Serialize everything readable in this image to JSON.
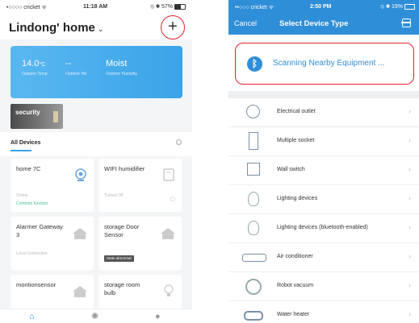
{
  "left": {
    "status": {
      "carrier": "•○○○○ cricket ᯤ",
      "time": "11:18 AM",
      "battery": "⦸ ✱ 57%"
    },
    "home_title": "Lindong' home",
    "add_label": "+",
    "weather": {
      "temp": "14.0",
      "temp_unit": "°C",
      "temp_label": "Outdoor Temp",
      "humidity": "--",
      "humidity_label": "Outdoor Hd",
      "quality": "Moist",
      "quality_label": "Outdoor Humidity"
    },
    "security_label": "security",
    "section_label": "All Devices",
    "cards": [
      {
        "name": "home 7C",
        "status": "Online",
        "extra": "Common function"
      },
      {
        "name": "WIFI humidifier",
        "status": "Turned Off"
      },
      {
        "name": "Alarmer Gateway 3",
        "status": "Local Connection"
      },
      {
        "name": "storage Door Sensor",
        "badge": "State abnormal"
      },
      {
        "name": "montionsensor"
      },
      {
        "name": "storage room bulb"
      }
    ],
    "tabs": [
      "⌂",
      "✺",
      "●"
    ]
  },
  "right": {
    "status": {
      "carrier": "••○○○ cricket ᯤ",
      "time": "2:50 PM",
      "battery": "⦸ ✱ 19%"
    },
    "cancel_label": "Cancel",
    "title": "Select Device Type",
    "scan_text": "Scanning Nearby Equipment ...",
    "bluetooth_glyph": "ᛒ",
    "arrow": "›",
    "devices": [
      {
        "label": "Electrical outlet",
        "icon": "outlet-icon"
      },
      {
        "label": "Multiple socket",
        "icon": "multi-socket-icon"
      },
      {
        "label": "Wall switch",
        "icon": "wall-switch-icon"
      },
      {
        "label": "Lighting devices",
        "icon": "bulb-icon"
      },
      {
        "label": "Lighting devices (bluetooth-enabled)",
        "icon": "bulb-icon"
      },
      {
        "label": "Air conditioner",
        "icon": "air-conditioner-icon"
      },
      {
        "label": "Robot vacuum",
        "icon": "robot-vacuum-icon"
      },
      {
        "label": "Water heater",
        "icon": "water-heater-icon"
      }
    ]
  },
  "colors": {
    "accent": "#2f8ed8",
    "highlight": "#e5232c",
    "online": "#3cbf8a"
  }
}
